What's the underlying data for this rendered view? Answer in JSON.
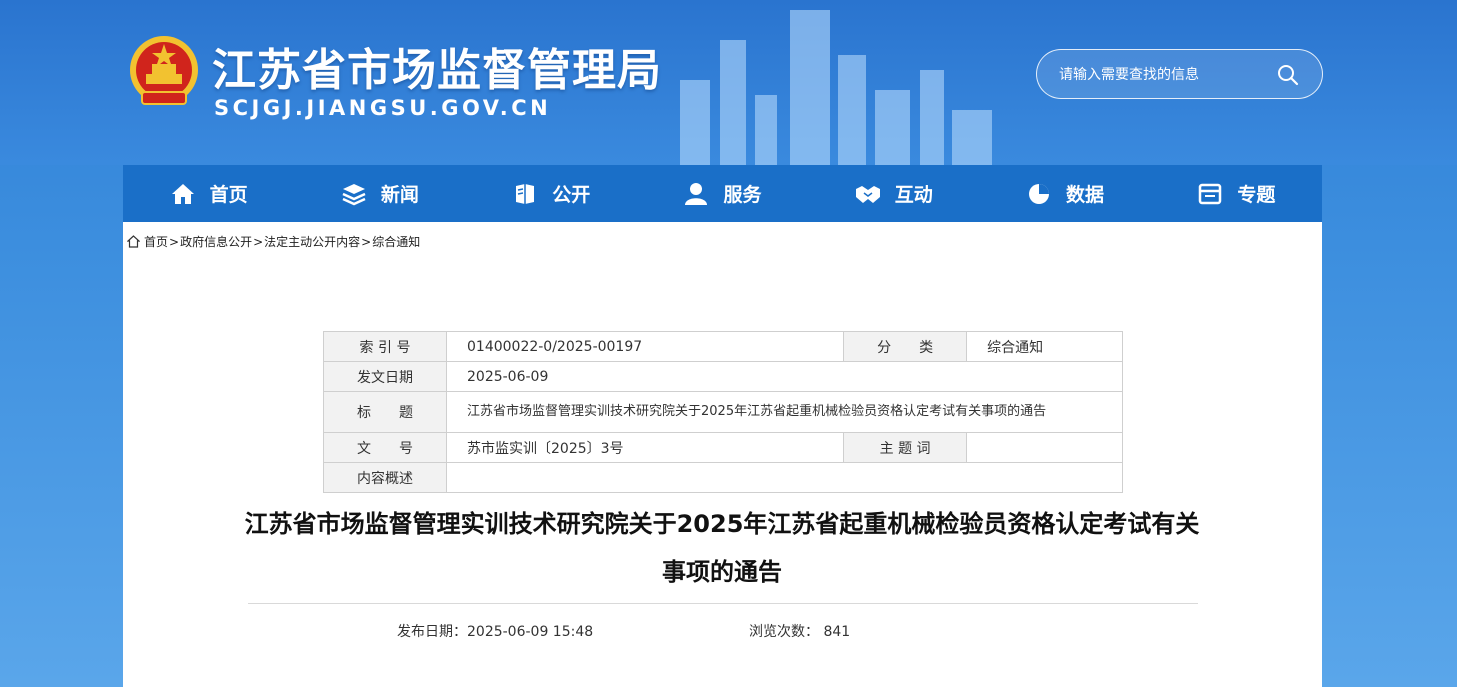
{
  "header": {
    "site_title": "江苏省市场监督管理局",
    "site_domain": "SCJGJ.JIANGSU.GOV.CN",
    "search_placeholder": "请输入需要查找的信息"
  },
  "nav": {
    "items": [
      {
        "label": "首页",
        "icon": "home-icon"
      },
      {
        "label": "新闻",
        "icon": "layers-icon"
      },
      {
        "label": "公开",
        "icon": "book-icon"
      },
      {
        "label": "服务",
        "icon": "user-icon"
      },
      {
        "label": "互动",
        "icon": "handshake-icon"
      },
      {
        "label": "数据",
        "icon": "pie-chart-icon"
      },
      {
        "label": "专题",
        "icon": "window-icon"
      }
    ]
  },
  "breadcrumb": {
    "items": [
      "首页",
      "政府信息公开",
      "法定主动公开内容",
      "综合通知"
    ],
    "separator": ">"
  },
  "meta": {
    "index_label": "索 引 号",
    "index_value": "01400022-0/2025-00197",
    "category_label": "分　　类",
    "category_value": "综合通知",
    "date_label": "发文日期",
    "date_value": "2025-06-09",
    "title_label": "标　　题",
    "title_value": "江苏省市场监督管理实训技术研究院关于2025年江苏省起重机械检验员资格认定考试有关事项的通告",
    "docno_label": "文　　号",
    "docno_value": "苏市监实训〔2025〕3号",
    "keyword_label": "主 题 词",
    "keyword_value": "",
    "summary_label": "内容概述",
    "summary_value": ""
  },
  "article": {
    "title": "江苏省市场监督管理实训技术研究院关于2025年江苏省起重机械检验员资格认定考试有关事项的通告",
    "pubdate_text": "发布日期：2025-06-09 15:48",
    "views_label": "浏览次数：",
    "views_value": "841"
  },
  "colors": {
    "nav_bg": "#1a6fc8",
    "header_bg": "#2a74cf",
    "emblem_red": "#d0241c",
    "emblem_gold": "#f2c230"
  }
}
